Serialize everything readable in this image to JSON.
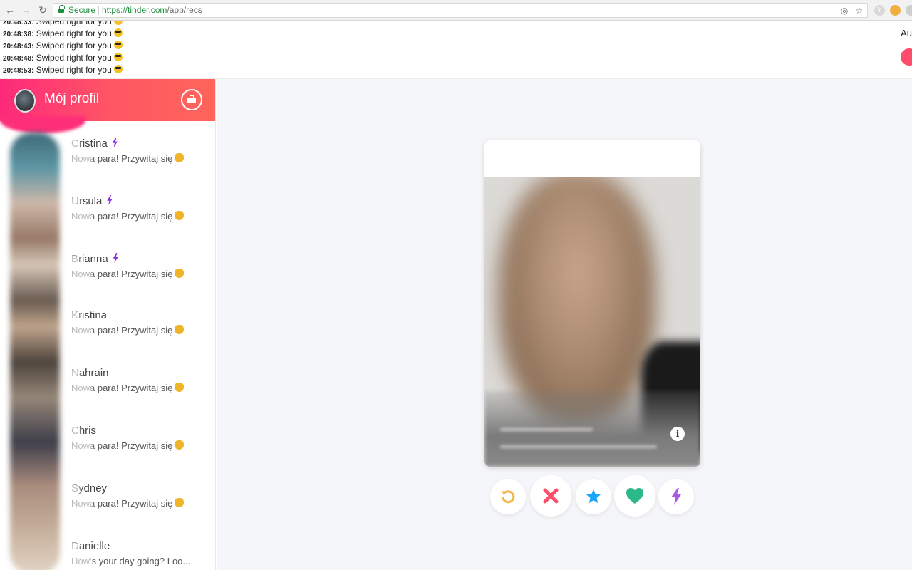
{
  "browser": {
    "secure_label": "Secure",
    "url_host": "https://tinder.com",
    "url_path": "/app/recs"
  },
  "log": {
    "lines": [
      {
        "time": "20:48:33:",
        "text": "Swiped right for you"
      },
      {
        "time": "20:48:38:",
        "text": "Swiped right for you"
      },
      {
        "time": "20:48:43:",
        "text": "Swiped right for you"
      },
      {
        "time": "20:48:48:",
        "text": "Swiped right for you"
      },
      {
        "time": "20:48:53:",
        "text": "Swiped right for you"
      }
    ],
    "right_text": "Au"
  },
  "sidebar": {
    "profile_title": "Mój profil",
    "matches": [
      {
        "name": "Cristina",
        "super": true,
        "message": "Nowa para! Przywitaj się"
      },
      {
        "name": "Ursula",
        "super": true,
        "message": "Nowa para! Przywitaj się"
      },
      {
        "name": "Brianna",
        "super": true,
        "message": "Nowa para! Przywitaj się"
      },
      {
        "name": "Kristina",
        "super": false,
        "message": "Nowa para! Przywitaj się"
      },
      {
        "name": "Nahrain",
        "super": false,
        "message": "Nowa para! Przywitaj się"
      },
      {
        "name": "Chris",
        "super": false,
        "message": "Nowa para! Przywitaj się"
      },
      {
        "name": "Sydney",
        "super": false,
        "message": "Nowa para! Przywitaj się"
      },
      {
        "name": "Danielle",
        "super": false,
        "message": "How's your day going? Loo..."
      }
    ]
  },
  "card": {
    "info_label": "i"
  },
  "actions": [
    {
      "name": "rewind",
      "icon": "rewind-icon",
      "color": "#f5b748"
    },
    {
      "name": "nope",
      "icon": "close-icon",
      "color": "#fd5068"
    },
    {
      "name": "super-like",
      "icon": "star-icon",
      "color": "#1ca4fc"
    },
    {
      "name": "like",
      "icon": "heart-icon",
      "color": "#2db887"
    },
    {
      "name": "boost",
      "icon": "bolt-icon",
      "color": "#a95ae0"
    }
  ]
}
